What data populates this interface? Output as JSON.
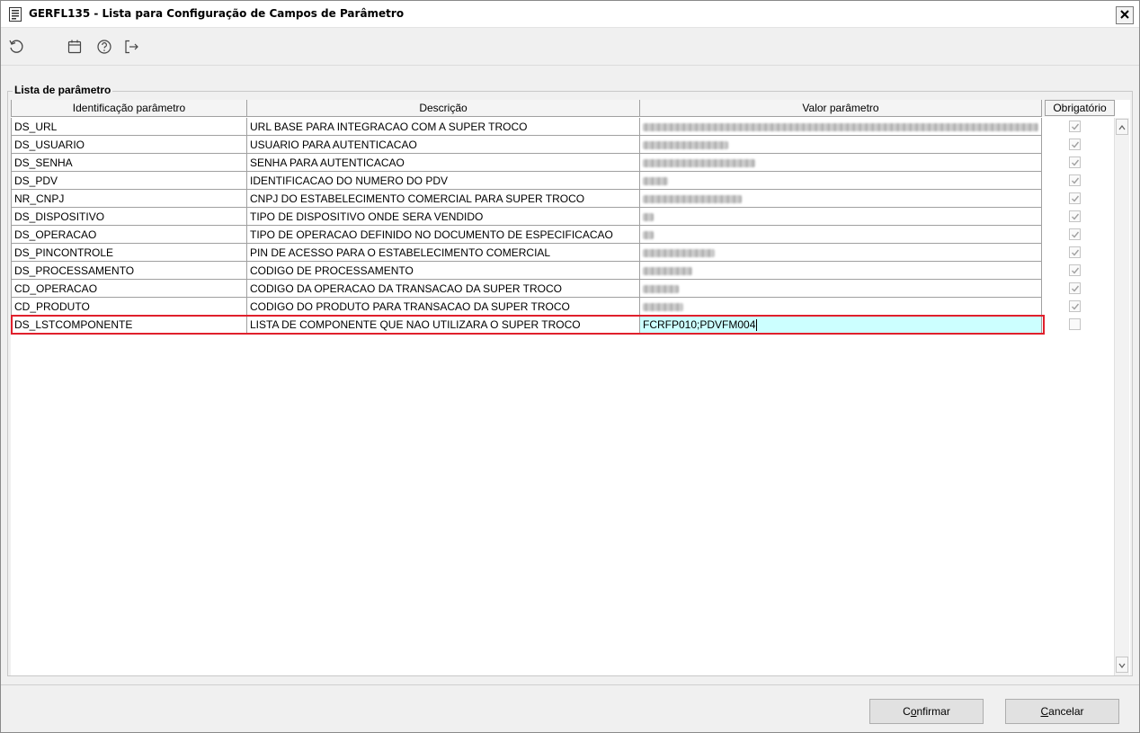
{
  "window": {
    "title": "GERFL135 - Lista para Configuração de Campos de Parâmetro",
    "close_glyph": "✕"
  },
  "toolbar": {
    "icons": [
      "refresh-icon",
      "calendar-icon",
      "help-icon",
      "exit-icon"
    ]
  },
  "group": {
    "label": "Lista de parâmetro"
  },
  "grid": {
    "columns": [
      "Identificação parâmetro",
      "Descrição",
      "Valor parâmetro",
      "Obrigatório"
    ],
    "rows": [
      {
        "id": "DS_URL",
        "descricao": "URL BASE PARA INTEGRACAO COM A SUPER TROCO",
        "valor": "",
        "obrigatorio": true
      },
      {
        "id": "DS_USUARIO",
        "descricao": "USUARIO PARA AUTENTICACAO",
        "valor": "",
        "obrigatorio": true
      },
      {
        "id": "DS_SENHA",
        "descricao": "SENHA PARA AUTENTICACAO",
        "valor": "",
        "obrigatorio": true
      },
      {
        "id": "DS_PDV",
        "descricao": "IDENTIFICACAO DO NUMERO DO PDV",
        "valor": "",
        "obrigatorio": true
      },
      {
        "id": "NR_CNPJ",
        "descricao": "CNPJ DO ESTABELECIMENTO COMERCIAL PARA SUPER TROCO",
        "valor": "",
        "obrigatorio": true
      },
      {
        "id": "DS_DISPOSITIVO",
        "descricao": "TIPO DE DISPOSITIVO ONDE SERA VENDIDO",
        "valor": "",
        "obrigatorio": true
      },
      {
        "id": "DS_OPERACAO",
        "descricao": "TIPO DE OPERACAO DEFINIDO NO DOCUMENTO DE ESPECIFICACAO",
        "valor": "",
        "obrigatorio": true
      },
      {
        "id": "DS_PINCONTROLE",
        "descricao": "PIN DE ACESSO PARA O ESTABELECIMENTO COMERCIAL",
        "valor": "",
        "obrigatorio": true
      },
      {
        "id": "DS_PROCESSAMENTO",
        "descricao": "CODIGO DE PROCESSAMENTO",
        "valor": "",
        "obrigatorio": true
      },
      {
        "id": "CD_OPERACAO",
        "descricao": "CODIGO DA OPERACAO DA TRANSACAO DA SUPER TROCO",
        "valor": "",
        "obrigatorio": true
      },
      {
        "id": "CD_PRODUTO",
        "descricao": "CODIGO DO PRODUTO PARA TRANSACAO DA SUPER TROCO",
        "valor": "",
        "obrigatorio": true
      },
      {
        "id": "DS_LSTCOMPONENTE",
        "descricao": "LISTA DE COMPONENTE QUE NAO UTILIZARA O SUPER TROCO",
        "valor": "FCRFP010;PDVFM004",
        "obrigatorio": false
      }
    ]
  },
  "buttons": {
    "confirm": {
      "pre": "C",
      "ul": "o",
      "post": "nfirmar"
    },
    "cancel": {
      "pre": "",
      "ul": "C",
      "post": "ancelar"
    }
  },
  "colors": {
    "selection_outline": "#e0202c",
    "edit_cell_bg": "#ccffff"
  }
}
